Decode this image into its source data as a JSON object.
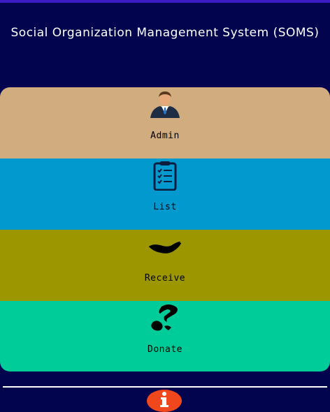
{
  "app": {
    "title": "Social Organization Management System (SOMS)"
  },
  "colors": {
    "background": "#02044e",
    "status_strip": "#3a1cc4",
    "divider": "#ffffff",
    "info_button": "#f0471c"
  },
  "menu": {
    "items": [
      {
        "label": "Admin",
        "icon": "admin-user-icon",
        "color": "#d1ac7e"
      },
      {
        "label": "List",
        "icon": "clipboard-list-icon",
        "color": "#0299cf"
      },
      {
        "label": "Receive",
        "icon": "receive-hand-icon",
        "color": "#9c9700"
      },
      {
        "label": "Donate",
        "icon": "donate-hand-icon",
        "color": "#00cc9a"
      }
    ]
  },
  "footer": {
    "info_icon": "info-icon"
  }
}
